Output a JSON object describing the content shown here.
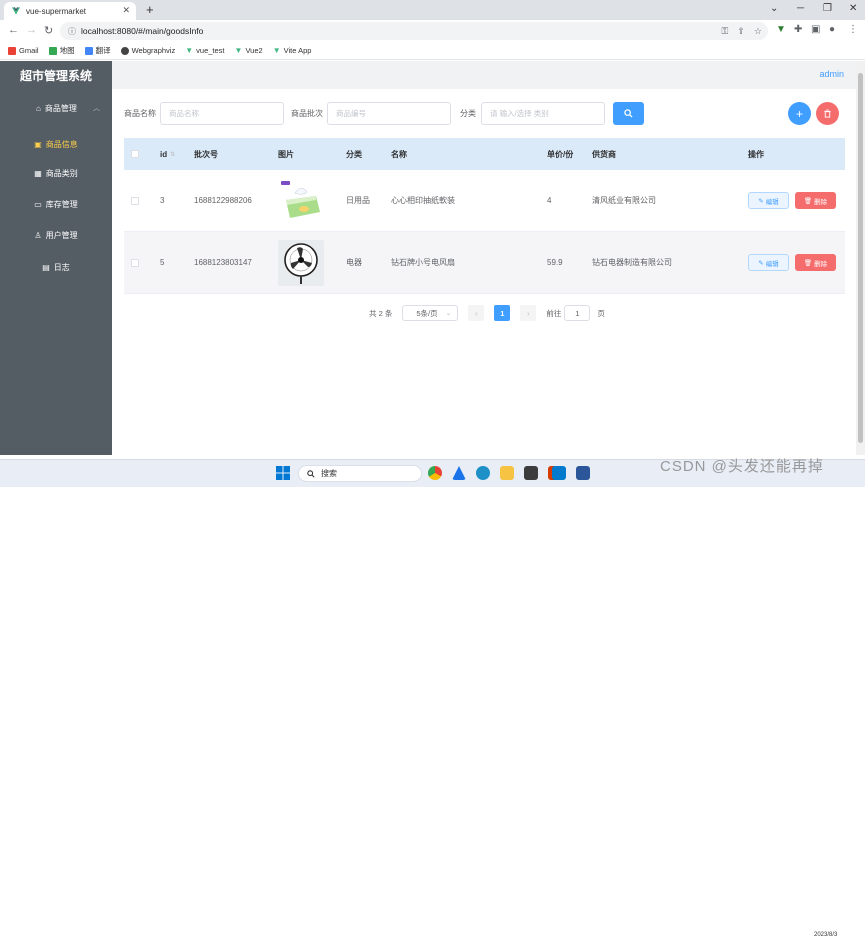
{
  "browser": {
    "tab_title": "vue-supermarket",
    "url": "localhost:8080/#/main/goodsInfo",
    "bookmarks": [
      "Gmail",
      "地图",
      "翻译",
      "Webgraphviz",
      "vue_test",
      "Vue2",
      "Vite App"
    ]
  },
  "sidebar": {
    "title": "超市管理系统",
    "group_label": "商品管理",
    "items": [
      {
        "label": "商品信息",
        "active": true
      },
      {
        "label": "商品类别",
        "active": false
      },
      {
        "label": "库存管理",
        "active": false
      },
      {
        "label": "用户管理",
        "active": false
      },
      {
        "label": "日志",
        "active": false
      }
    ]
  },
  "header": {
    "user": "admin"
  },
  "filter": {
    "name_label": "商品名称",
    "name_placeholder": "商品名称",
    "batch_label": "商品批次",
    "batch_placeholder": "商品编号",
    "category_label": "分类",
    "category_placeholder": "请 输入/选择 类别"
  },
  "table": {
    "headers": [
      "id",
      "批次号",
      "图片",
      "分类",
      "名称",
      "单价/份",
      "供货商",
      "操作"
    ],
    "rows": [
      {
        "id": "3",
        "batch": "1688122988206",
        "image": "tissue-box-image",
        "category": "日用品",
        "name": "心心相印抽纸軟装",
        "price": "4",
        "supplier": "清风纸业有限公司"
      },
      {
        "id": "5",
        "batch": "1688123803147",
        "image": "fan-image",
        "category": "电器",
        "name": "钻石牌小号电风扇",
        "price": "59.9",
        "supplier": "钻石电器制造有限公司"
      }
    ],
    "edit_label": "编辑",
    "delete_label": "删除"
  },
  "pagination": {
    "total": "共 2 条",
    "page_size": "5条/页",
    "current_page": "1",
    "goto_label": "前往",
    "goto_value": "1",
    "page_suffix": "页"
  },
  "taskbar": {
    "search_placeholder": "搜索",
    "date": "2023/8/3"
  },
  "watermark": "CSDN @头发还能再掉",
  "colors": {
    "primary": "#409eff",
    "danger": "#f56c6c",
    "sidebar": "#545c64",
    "active_menu": "#ffd04b"
  }
}
